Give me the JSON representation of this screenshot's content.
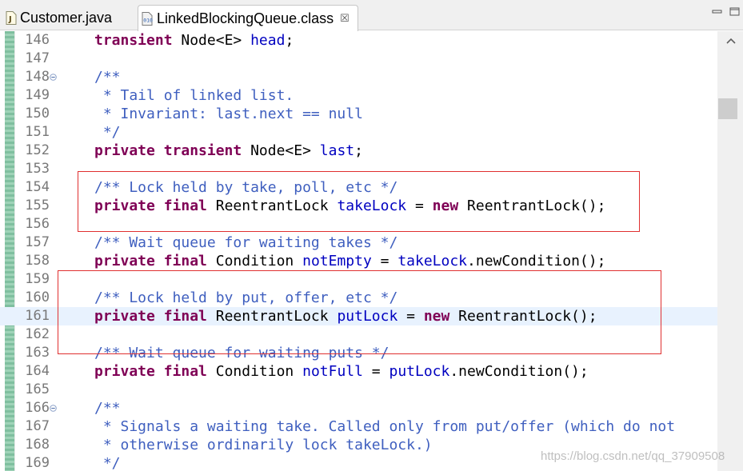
{
  "tabs": [
    {
      "label": "Customer.java",
      "icon": "java-file-icon",
      "active": false
    },
    {
      "label": "LinkedBlockingQueue.class",
      "icon": "class-file-icon",
      "active": true,
      "close": "☒"
    }
  ],
  "colors": {
    "keyword": "#7f0055",
    "field": "#0000c0",
    "comment": "#3f5fbf",
    "highlight_box": "#e03030",
    "current_line": "#e8f2fe"
  },
  "editor": {
    "current_line": 161,
    "lines": [
      {
        "n": "146",
        "tokens": [
          [
            "kw",
            "transient"
          ],
          [
            "",
            " Node<E> "
          ],
          [
            "fld",
            "head"
          ],
          [
            "",
            ";"
          ]
        ]
      },
      {
        "n": "147",
        "tokens": []
      },
      {
        "n": "148",
        "fold": true,
        "tokens": [
          [
            "cm",
            "/**"
          ]
        ]
      },
      {
        "n": "149",
        "tokens": [
          [
            "cm",
            " * Tail of linked list."
          ]
        ]
      },
      {
        "n": "150",
        "tokens": [
          [
            "cm",
            " * Invariant: last.next == null"
          ]
        ]
      },
      {
        "n": "151",
        "tokens": [
          [
            "cm",
            " */"
          ]
        ]
      },
      {
        "n": "152",
        "tokens": [
          [
            "kw",
            "private transient"
          ],
          [
            "",
            " Node<E> "
          ],
          [
            "fld",
            "last"
          ],
          [
            "",
            ";"
          ]
        ]
      },
      {
        "n": "153",
        "tokens": []
      },
      {
        "n": "154",
        "tokens": [
          [
            "cm",
            "/** Lock held by take, poll, etc */"
          ]
        ]
      },
      {
        "n": "155",
        "tokens": [
          [
            "kw",
            "private final"
          ],
          [
            "",
            " ReentrantLock "
          ],
          [
            "fld",
            "takeLock"
          ],
          [
            "",
            " = "
          ],
          [
            "kw",
            "new"
          ],
          [
            "",
            " ReentrantLock();"
          ]
        ]
      },
      {
        "n": "156",
        "tokens": []
      },
      {
        "n": "157",
        "tokens": [
          [
            "cm",
            "/** Wait queue for waiting takes */"
          ]
        ]
      },
      {
        "n": "158",
        "tokens": [
          [
            "kw",
            "private final"
          ],
          [
            "",
            " Condition "
          ],
          [
            "fld",
            "notEmpty"
          ],
          [
            "",
            " = "
          ],
          [
            "fld",
            "takeLock"
          ],
          [
            "",
            ".newCondition();"
          ]
        ]
      },
      {
        "n": "159",
        "tokens": []
      },
      {
        "n": "160",
        "tokens": [
          [
            "cm",
            "/** Lock held by put, offer, etc */"
          ]
        ]
      },
      {
        "n": "161",
        "tokens": [
          [
            "kw",
            "private final"
          ],
          [
            "",
            " ReentrantLock "
          ],
          [
            "fld",
            "putLock"
          ],
          [
            "",
            " = "
          ],
          [
            "kw",
            "new"
          ],
          [
            "",
            " ReentrantLock();"
          ]
        ]
      },
      {
        "n": "162",
        "tokens": []
      },
      {
        "n": "163",
        "tokens": [
          [
            "cm",
            "/** Wait queue for waiting puts */"
          ]
        ]
      },
      {
        "n": "164",
        "tokens": [
          [
            "kw",
            "private final"
          ],
          [
            "",
            " Condition "
          ],
          [
            "fld",
            "notFull"
          ],
          [
            "",
            " = "
          ],
          [
            "fld",
            "putLock"
          ],
          [
            "",
            ".newCondition();"
          ]
        ]
      },
      {
        "n": "165",
        "tokens": []
      },
      {
        "n": "166",
        "fold": true,
        "tokens": [
          [
            "cm",
            "/**"
          ]
        ]
      },
      {
        "n": "167",
        "tokens": [
          [
            "cm",
            " * Signals a waiting take. Called only from put/offer (which do not"
          ]
        ]
      },
      {
        "n": "168",
        "tokens": [
          [
            "cm",
            " * otherwise ordinarily lock takeLock.)"
          ]
        ]
      },
      {
        "n": "169",
        "tokens": [
          [
            "cm",
            " */"
          ]
        ]
      }
    ]
  },
  "watermark": "https://blog.csdn.net/qq_37909508"
}
